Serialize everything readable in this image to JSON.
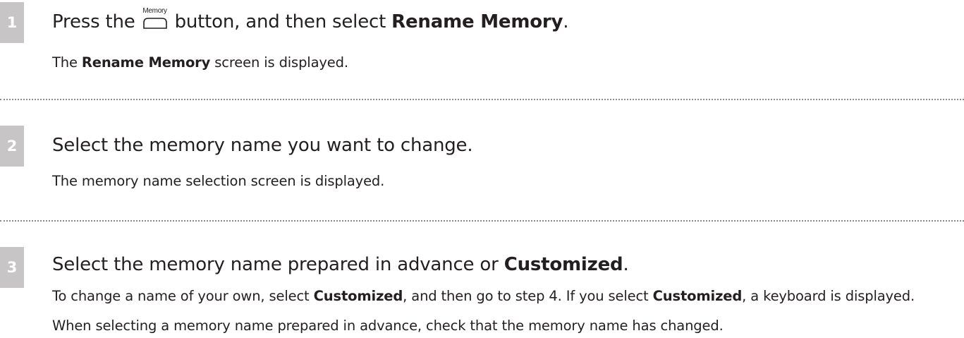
{
  "steps": [
    {
      "number": "1",
      "heading": {
        "before": "Press the",
        "button_label": "Memory",
        "middle": "button, and then select",
        "bold": "Rename Memory",
        "after": "."
      },
      "body": [
        {
          "parts": [
            {
              "text": "The ",
              "bold": false
            },
            {
              "text": "Rename Memory",
              "bold": true
            },
            {
              "text": " screen is displayed.",
              "bold": false
            }
          ]
        }
      ]
    },
    {
      "number": "2",
      "heading": {
        "text": "Select the memory name you want to change."
      },
      "body": [
        {
          "parts": [
            {
              "text": "The memory name selection screen is displayed.",
              "bold": false
            }
          ]
        }
      ]
    },
    {
      "number": "3",
      "heading": {
        "before": "Select the memory name prepared in advance or",
        "bold": "Customized",
        "after": "."
      },
      "body": [
        {
          "parts": [
            {
              "text": "To change a name of your own, select ",
              "bold": false
            },
            {
              "text": "Customized",
              "bold": true
            },
            {
              "text": ", and then go to step 4. If you select ",
              "bold": false
            },
            {
              "text": "Customized",
              "bold": true
            },
            {
              "text": ", a keyboard is displayed.",
              "bold": false
            }
          ]
        },
        {
          "parts": [
            {
              "text": "When selecting a memory name prepared in advance, check that the memory name has changed.",
              "bold": false
            }
          ]
        }
      ]
    }
  ]
}
